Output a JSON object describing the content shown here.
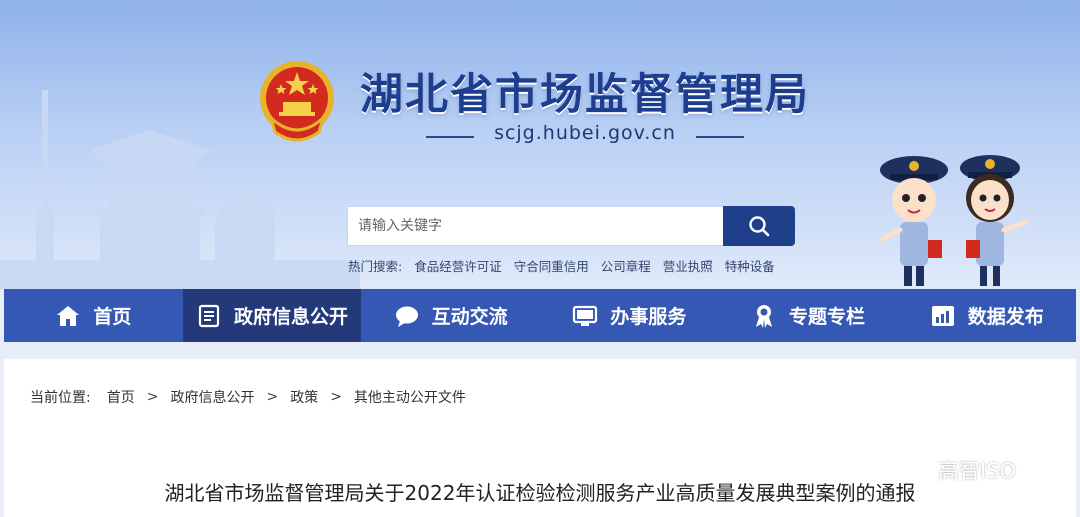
{
  "header": {
    "site_title": "湖北省市场监督管理局",
    "domain": "scjg.hubei.gov.cn"
  },
  "search": {
    "placeholder": "请输入关键字",
    "button_icon": "search-icon"
  },
  "hot_search": {
    "label": "热门搜索:",
    "links": [
      "食品经营许可证",
      "守合同重信用",
      "公司章程",
      "营业执照",
      "特种设备"
    ]
  },
  "nav": {
    "items": [
      {
        "label": "首页",
        "icon": "home-icon"
      },
      {
        "label": "政府信息公开",
        "icon": "document-icon",
        "active": true
      },
      {
        "label": "互动交流",
        "icon": "chat-icon"
      },
      {
        "label": "办事服务",
        "icon": "monitor-icon"
      },
      {
        "label": "专题专栏",
        "icon": "award-icon"
      },
      {
        "label": "数据发布",
        "icon": "chart-icon"
      }
    ]
  },
  "breadcrumb": {
    "label": "当前位置:",
    "items": [
      "首页",
      "政府信息公开",
      "政策",
      "其他主动公开文件"
    ],
    "separator": ">"
  },
  "article": {
    "title": "湖北省市场监督管理局关于2022年认证检验检测服务产业高质量发展典型案例的通报"
  },
  "watermark": {
    "text": "高智ISO"
  },
  "colors": {
    "nav_bg": "#3558b4",
    "nav_active": "#24397a",
    "title_blue": "#1d3d8f",
    "search_button": "#1f3f8a"
  }
}
